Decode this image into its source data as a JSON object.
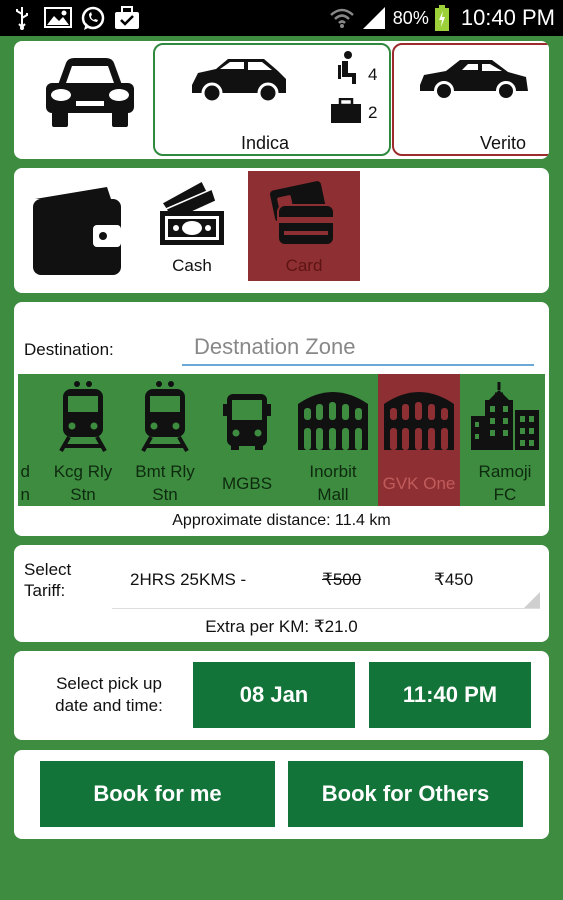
{
  "status_bar": {
    "battery_percent": "80%",
    "time": "10:40 PM",
    "icons": [
      "usb-icon",
      "image-icon",
      "whatsapp-icon",
      "briefcase-icon",
      "wifi-icon",
      "signal-icon",
      "battery-icon"
    ]
  },
  "vehicles": {
    "options": [
      {
        "label": "Indica",
        "seats": "4",
        "bags": "2",
        "state": "selected-green"
      },
      {
        "label": "Verito",
        "state": "outlined-red"
      }
    ]
  },
  "payment": {
    "options": [
      {
        "label": "Cash"
      },
      {
        "label": "Card",
        "selected": true
      }
    ]
  },
  "destination": {
    "label": "Destination:",
    "placeholder": "Destnation Zone",
    "zones": [
      {
        "label": "d\nn"
      },
      {
        "label": "Kcg Rly\nStn",
        "icon": "train-icon"
      },
      {
        "label": "Bmt Rly\nStn",
        "icon": "train-icon"
      },
      {
        "label": "MGBS",
        "icon": "bus-icon"
      },
      {
        "label": "Inorbit\nMall",
        "icon": "colosseum-icon"
      },
      {
        "label": "GVK One",
        "icon": "colosseum-icon",
        "selected": true
      },
      {
        "label": "Ramoji\nFC",
        "icon": "buildings-icon"
      }
    ],
    "approx_distance": "Approximate distance: 11.4 km"
  },
  "tariff": {
    "label": "Select\nTariff:",
    "name": "2HRS 25KMS -",
    "old_price": "₹500",
    "new_price": "₹450",
    "extra_per_km": "Extra per KM: ₹21.0"
  },
  "pickup": {
    "label": "Select pick up\ndate and time:",
    "date": "08 Jan",
    "time": "11:40 PM"
  },
  "booking": {
    "book_me": "Book for me",
    "book_others": "Book for Others"
  },
  "colors": {
    "background_green": "#3d8c40",
    "button_green": "#13743a",
    "selected_red": "#8e2f33",
    "input_underline": "#6aa8d6"
  }
}
